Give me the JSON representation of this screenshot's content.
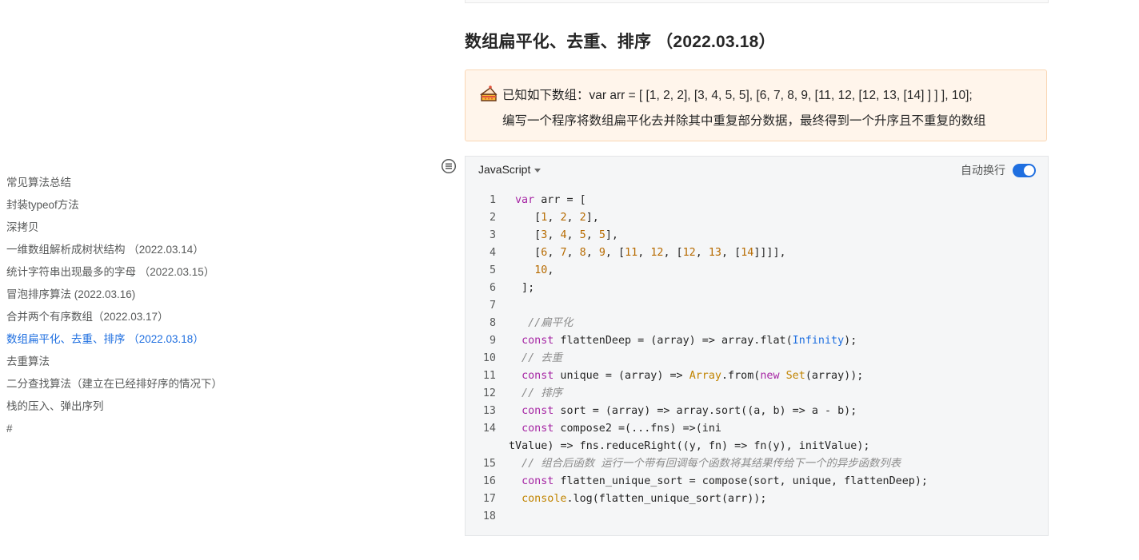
{
  "heading": "数组扁平化、去重、排序 （2022.03.18）",
  "callout": {
    "icon": "cake-emoji-icon",
    "line1": "已知如下数组：var arr = [ [1, 2, 2], [3, 4, 5, 5], [6, 7, 8, 9, [11, 12, [12, 13, [14] ] ] ], 10];",
    "line2": "编写一个程序将数组扁平化去并除其中重复部分数据，最终得到一个升序且不重复的数组"
  },
  "toc": {
    "items": [
      {
        "label": "常见算法总结",
        "active": false
      },
      {
        "label": "封装typeof方法",
        "active": false
      },
      {
        "label": "深拷贝",
        "active": false
      },
      {
        "label": "一维数组解析成树状结构 （2022.03.14）",
        "active": false
      },
      {
        "label": "统计字符串出现最多的字母 （2022.03.15）",
        "active": false
      },
      {
        "label": "冒泡排序算法 (2022.03.16)",
        "active": false
      },
      {
        "label": "合并两个有序数组（2022.03.17）",
        "active": false
      },
      {
        "label": "数组扁平化、去重、排序 （2022.03.18）",
        "active": true
      },
      {
        "label": "去重算法",
        "active": false
      },
      {
        "label": "二分查找算法（建立在已经排好序的情况下）",
        "active": false
      },
      {
        "label": "栈的压入、弹出序列",
        "active": false
      },
      {
        "label": "#",
        "active": false
      }
    ]
  },
  "code_block": {
    "language": "JavaScript",
    "wrap_label": "自动换行",
    "wrap_enabled": true,
    "lines": [
      {
        "n": "1",
        "text": "var arr = ["
      },
      {
        "n": "2",
        "text": "   [1, 2, 2],"
      },
      {
        "n": "3",
        "text": "   [3, 4, 5, 5],"
      },
      {
        "n": "4",
        "text": "   [6, 7, 8, 9, [11, 12, [12, 13, [14]]]],"
      },
      {
        "n": "5",
        "text": "   10,"
      },
      {
        "n": "6",
        "text": " ];"
      },
      {
        "n": "7",
        "text": ""
      },
      {
        "n": "8",
        "text": "  //扁平化"
      },
      {
        "n": "9",
        "text": " const flattenDeep = (array) => array.flat(Infinity);"
      },
      {
        "n": "10",
        "text": " // 去重"
      },
      {
        "n": "11",
        "text": " const unique = (array) => Array.from(new Set(array));"
      },
      {
        "n": "12",
        "text": " // 排序"
      },
      {
        "n": "13",
        "text": " const sort = (array) => array.sort((a, b) => a - b);"
      },
      {
        "n": "14",
        "text": " const compose2 =(...fns) =>(initValue) => fns.reduceRight((y, fn) => fn(y), initValue);"
      },
      {
        "n": "15",
        "text": " // 组合后函数 运行一个带有回调每个函数将其结果传给下一个的异步函数列表"
      },
      {
        "n": "16",
        "text": " const flatten_unique_sort = compose(sort, unique, flattenDeep);"
      },
      {
        "n": "17",
        "text": " console.log(flatten_unique_sort(arr));"
      },
      {
        "n": "18",
        "text": ""
      }
    ]
  }
}
